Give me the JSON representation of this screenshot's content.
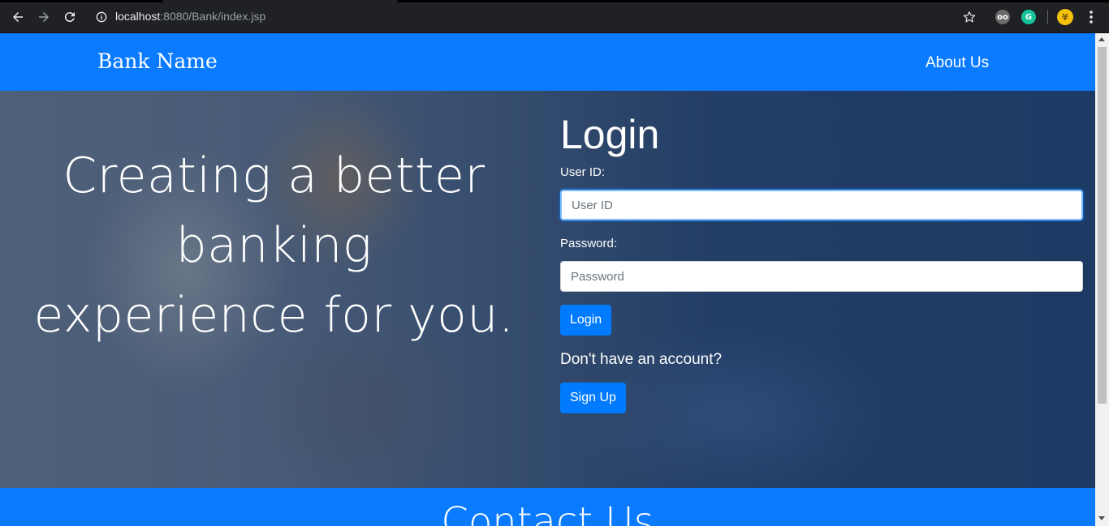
{
  "browser": {
    "url_host": "localhost",
    "url_rest": ":8080/Bank/index.jsp",
    "icons": {
      "back": "arrow-left-icon",
      "forward": "arrow-right-icon",
      "reload": "reload-icon",
      "info": "info-icon",
      "bookmark": "star-icon",
      "menu": "kebab-menu-icon"
    },
    "extensions": [
      "glasses-extension-icon",
      "grammarly-extension-icon"
    ]
  },
  "navbar": {
    "brand": "Bank Name",
    "about_link": "About Us",
    "background": "#0a7bff"
  },
  "hero": {
    "tagline": "Creating a better banking experience for you."
  },
  "login": {
    "title": "Login",
    "userid_label": "User ID:",
    "userid_placeholder": "User ID",
    "userid_value": "",
    "password_label": "Password:",
    "password_placeholder": "Password",
    "password_value": "",
    "login_button": "Login",
    "no_account_text": "Don't have an account?",
    "signup_button": "Sign Up",
    "button_color": "#007bff"
  },
  "footer": {
    "title": "Contact Us"
  }
}
